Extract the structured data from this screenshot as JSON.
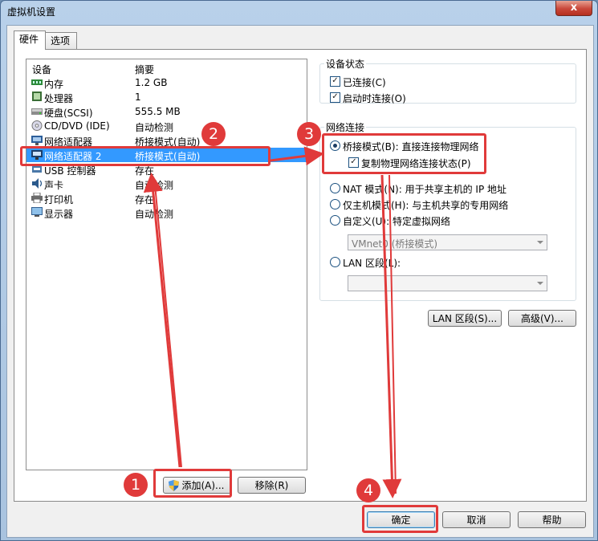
{
  "window": {
    "title": "虚拟机设置",
    "close_glyph": "x"
  },
  "tabs": [
    {
      "label": "硬件",
      "active": true
    },
    {
      "label": "选项",
      "active": false
    }
  ],
  "device_list": {
    "headers": {
      "device": "设备",
      "summary": "摘要"
    },
    "rows": [
      {
        "icon": "memory-icon",
        "name": "内存",
        "summary": "1.2 GB",
        "selected": false
      },
      {
        "icon": "processor-icon",
        "name": "处理器",
        "summary": "1",
        "selected": false
      },
      {
        "icon": "hard-disk-icon",
        "name": "硬盘(SCSI)",
        "summary": "555.5 MB",
        "selected": false
      },
      {
        "icon": "cd-dvd-icon",
        "name": "CD/DVD (IDE)",
        "summary": "自动检测",
        "selected": false
      },
      {
        "icon": "network-adapter-icon",
        "name": "网络适配器",
        "summary": "桥接模式(自动)",
        "selected": false
      },
      {
        "icon": "network-adapter-icon",
        "name": "网络适配器 2",
        "summary": "桥接模式(自动)",
        "selected": true
      },
      {
        "icon": "usb-controller-icon",
        "name": "USB 控制器",
        "summary": "存在",
        "selected": false
      },
      {
        "icon": "sound-card-icon",
        "name": "声卡",
        "summary": "自动检测",
        "selected": false
      },
      {
        "icon": "printer-icon",
        "name": "打印机",
        "summary": "存在",
        "selected": false
      },
      {
        "icon": "display-icon",
        "name": "显示器",
        "summary": "自动检测",
        "selected": false
      }
    ],
    "add_label": "添加(A)...",
    "remove_label": "移除(R)"
  },
  "device_status": {
    "title": "设备状态",
    "connected_label": "已连接(C)",
    "connected_checked": true,
    "connect_at_power_on_label": "启动时连接(O)",
    "connect_at_power_on_checked": true
  },
  "network_connection": {
    "title": "网络连接",
    "bridged_label": "桥接模式(B): 直接连接物理网络",
    "bridged_selected": true,
    "replicate_label": "复制物理网络连接状态(P)",
    "replicate_checked": true,
    "nat_label": "NAT 模式(N): 用于共享主机的 IP 地址",
    "host_only_label": "仅主机模式(H): 与主机共享的专用网络",
    "custom_label": "自定义(U): 特定虚拟网络",
    "custom_value": "VMnet0 (桥接模式)",
    "lan_segment_label": "LAN 区段(L):",
    "lan_segment_value": ""
  },
  "buttons": {
    "lan_segments": "LAN 区段(S)...",
    "advanced": "高级(V)...",
    "ok": "确定",
    "cancel": "取消",
    "help": "帮助"
  },
  "annotations": {
    "step1": "1",
    "step2": "2",
    "step3": "3",
    "step4": "4",
    "color": "#e03a3a"
  }
}
